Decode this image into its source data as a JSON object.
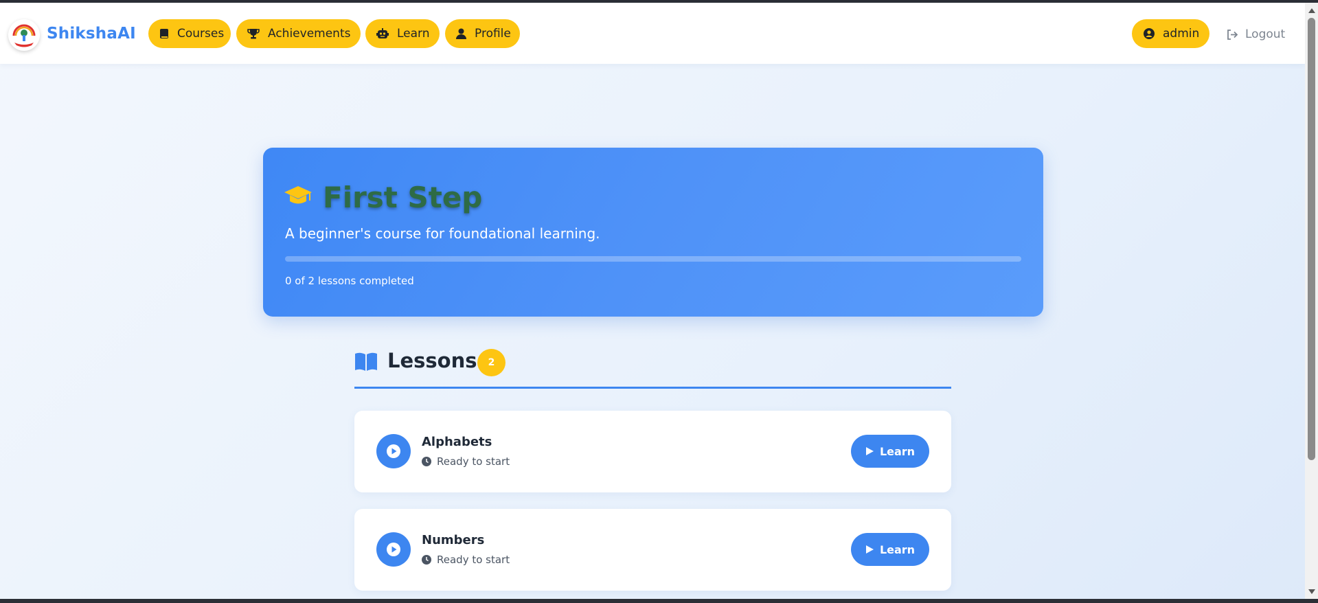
{
  "app": {
    "brand": "ShikshaAI"
  },
  "nav": {
    "items": [
      {
        "label": "Courses",
        "icon": "book-icon"
      },
      {
        "label": "Achievements",
        "icon": "trophy-icon"
      },
      {
        "label": "Learn",
        "icon": "robot-icon"
      },
      {
        "label": "Profile",
        "icon": "user-icon"
      }
    ],
    "user_label": "admin",
    "logout_label": "Logout"
  },
  "course": {
    "title": "First Step",
    "description": "A beginner's course for foundational learning.",
    "progress_text": "0 of 2 lessons completed",
    "progress_fraction": 0
  },
  "lessons": {
    "heading": "Lessons",
    "count": "2",
    "items": [
      {
        "name": "Alphabets",
        "status": "Ready to start",
        "button": "Learn"
      },
      {
        "name": "Numbers",
        "status": "Ready to start",
        "button": "Learn"
      }
    ]
  },
  "colors": {
    "accent_yellow": "#fdc512",
    "primary_blue": "#3d86f0",
    "title_green": "#2e6b46"
  }
}
